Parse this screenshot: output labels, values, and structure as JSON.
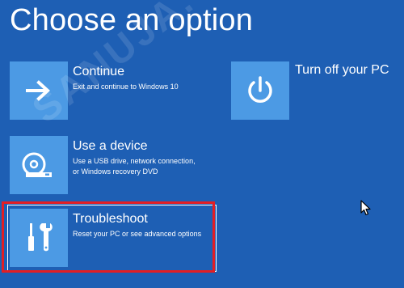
{
  "page": {
    "title": "Choose an option"
  },
  "options": [
    {
      "title": "Continue",
      "desc": [
        "Exit and continue to Windows 10"
      ],
      "icon": "arrow-right-icon"
    },
    {
      "title": "Use a device",
      "desc": [
        "Use a USB drive, network connection,",
        "or Windows recovery DVD"
      ],
      "icon": "disc-drive-icon"
    },
    {
      "title": "Troubleshoot",
      "desc": [
        "Reset your PC or see advanced options"
      ],
      "icon": "tools-icon"
    },
    {
      "title": "Turn off your PC",
      "desc": [],
      "icon": "power-icon"
    }
  ],
  "watermark": {
    "text": "SANUJA.COM"
  },
  "colors": {
    "background": "#1e5fb4",
    "tile": "#4c9ae4",
    "highlight": "#e31e24"
  }
}
